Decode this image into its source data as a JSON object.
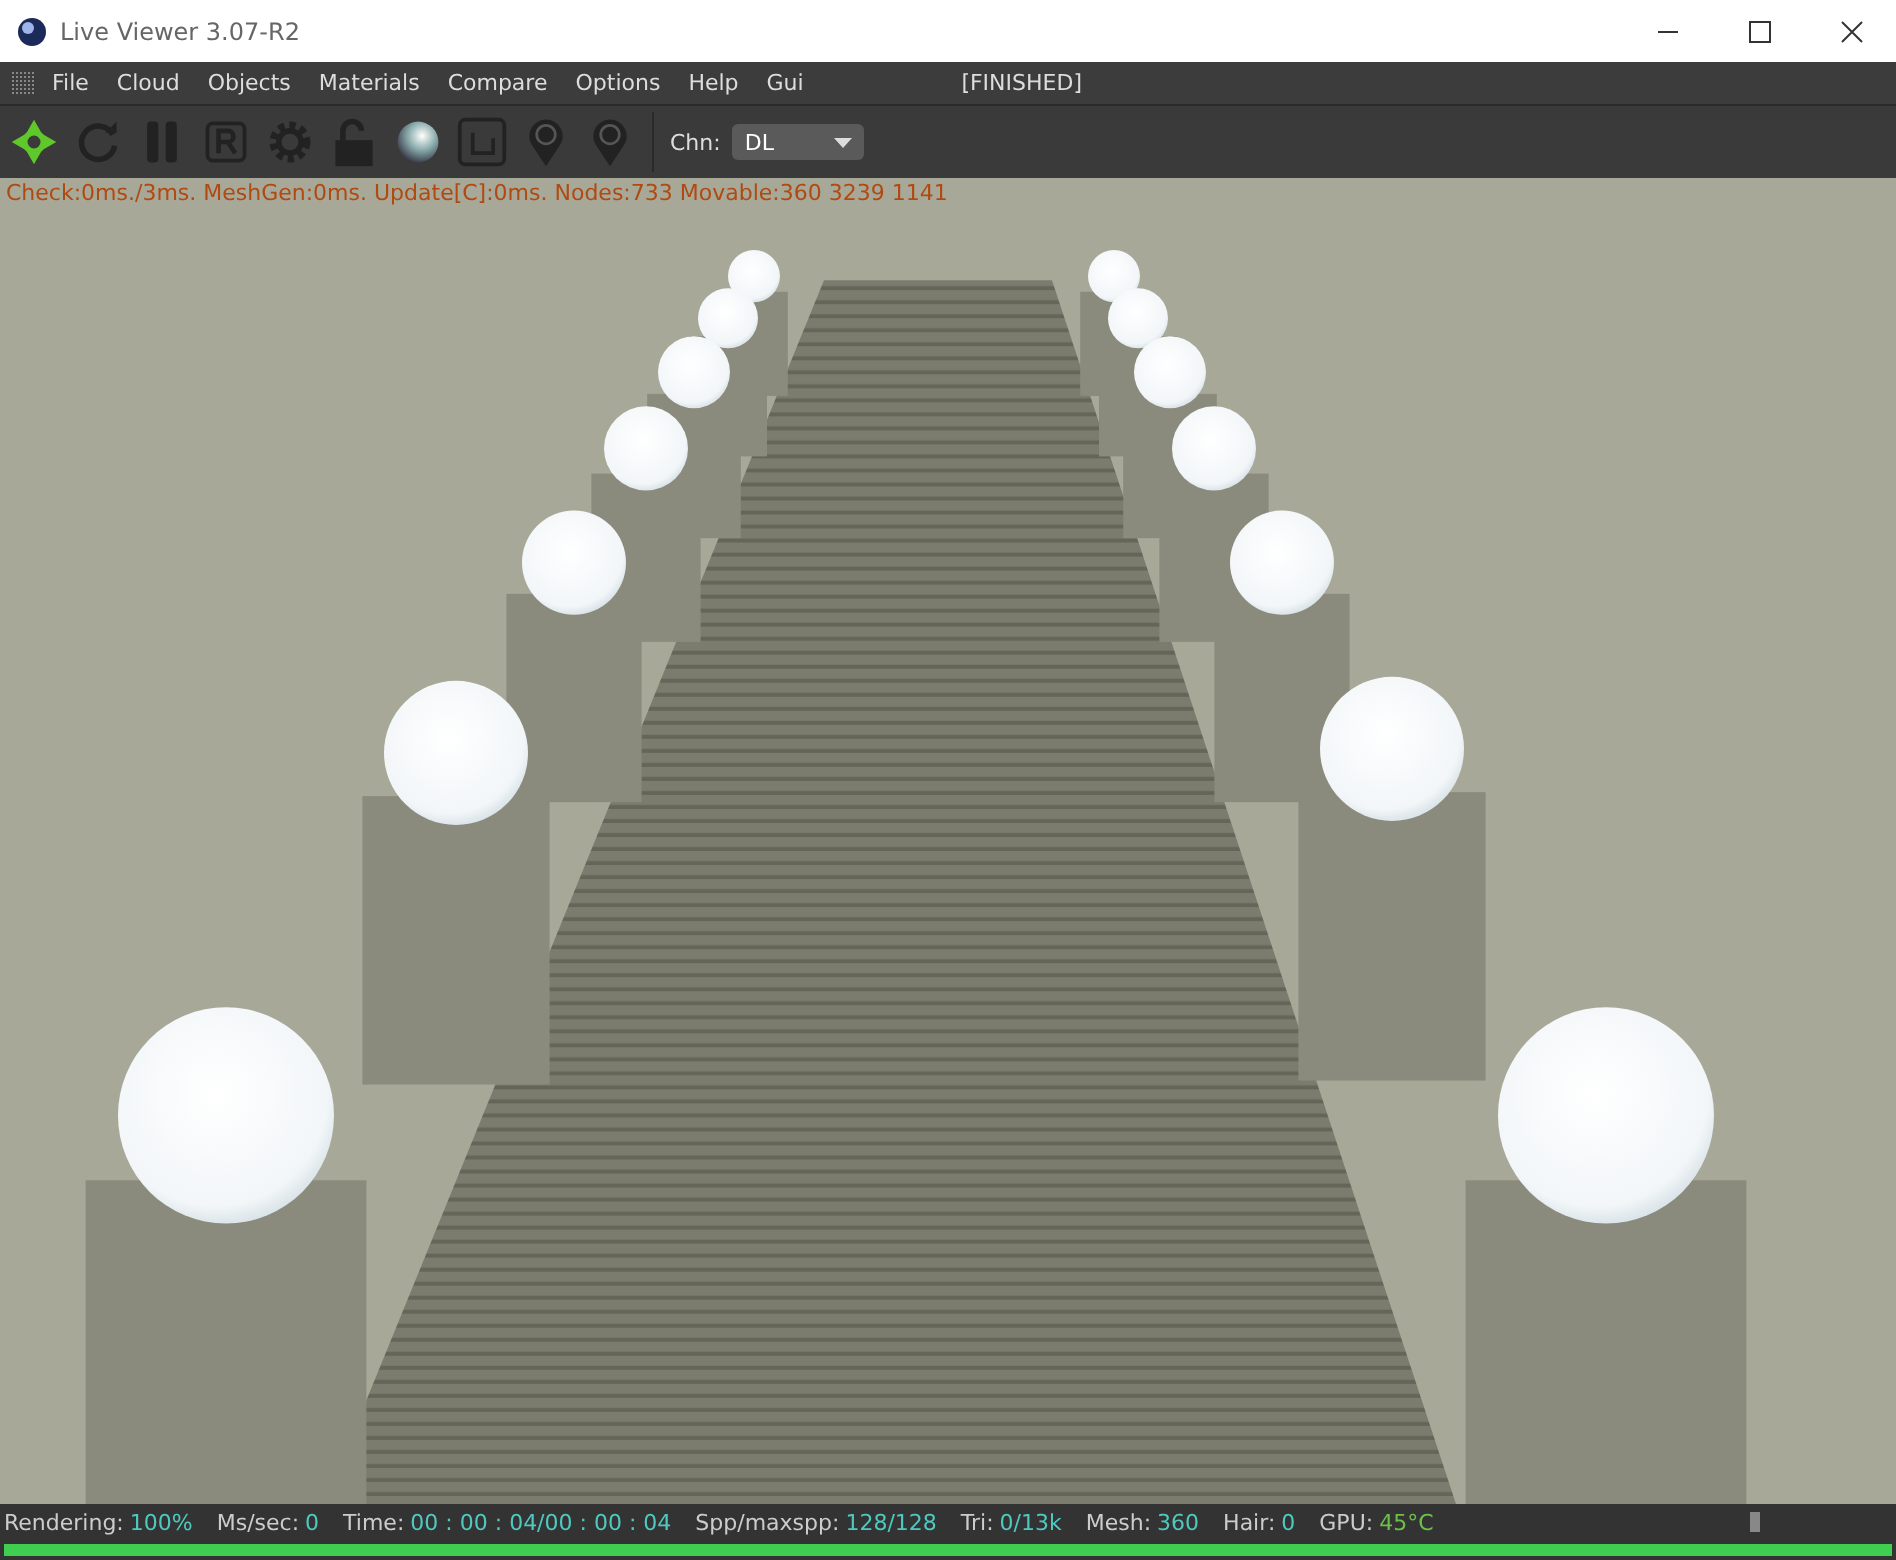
{
  "window": {
    "title": "Live Viewer 3.07-R2"
  },
  "menu": [
    "File",
    "Cloud",
    "Objects",
    "Materials",
    "Compare",
    "Options",
    "Help",
    "Gui"
  ],
  "render_state": "[FINISHED]",
  "channel": {
    "label": "Chn:",
    "value": "DL"
  },
  "stats_line": "Check:0ms./3ms. MeshGen:0ms. Update[C]:0ms. Nodes:733 Movable:360  3239 1141",
  "status_bar": [
    {
      "label": "Rendering:",
      "value": "100%",
      "color": "#4fc9c0"
    },
    {
      "label": "Ms/sec:",
      "value": "0",
      "color": "#4fc9c0"
    },
    {
      "label": "Time:",
      "value": "00 : 00 : 04/00 : 00 : 04",
      "color": "#4fc9c0"
    },
    {
      "label": "Spp/maxspp:",
      "value": "128/128",
      "color": "#4fc9c0"
    },
    {
      "label": "Tri:",
      "value": "0/13k",
      "color": "#4fc9c0"
    },
    {
      "label": "Mesh:",
      "value": "360",
      "color": "#4fc9c0"
    },
    {
      "label": "Hair:",
      "value": "0",
      "color": "#4fc9c0"
    },
    {
      "label": "GPU:",
      "value": "45°C",
      "color": "#6cc04a"
    }
  ],
  "progress": {
    "level": 1
  }
}
